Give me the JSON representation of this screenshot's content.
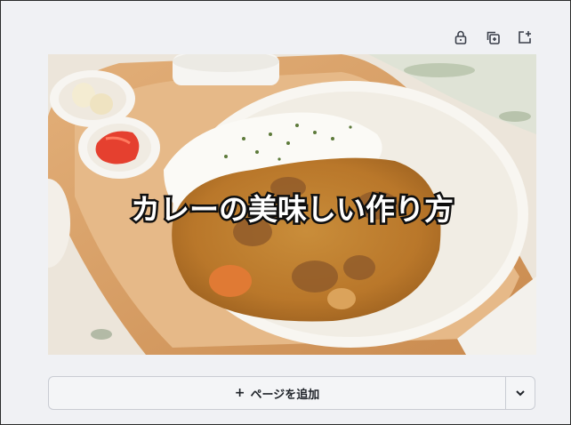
{
  "toolbar": {
    "lock_icon": "lock-icon",
    "duplicate_icon": "duplicate-page-icon",
    "add_icon": "add-page-icon"
  },
  "page": {
    "title": "カレーの美味しい作り方",
    "image": "curry-rice-photo"
  },
  "add_bar": {
    "plus": "+",
    "label": "ページを追加",
    "dropdown_icon": "chevron-down-icon"
  },
  "colors": {
    "background": "#f0f1f4",
    "button_border": "#c9ccd3",
    "text": "#1f2329"
  }
}
